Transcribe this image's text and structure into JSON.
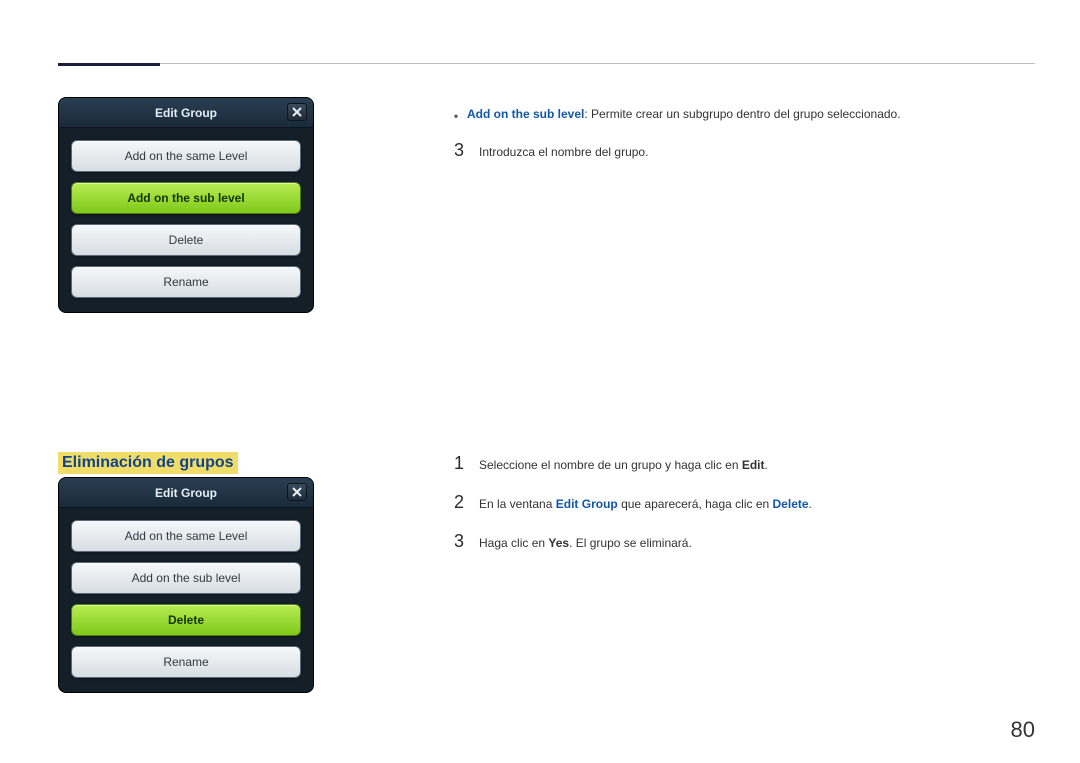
{
  "page": {
    "number": "80"
  },
  "dialog1": {
    "title": "Edit Group",
    "buttons": {
      "same": "Add on the same Level",
      "sub": "Add on the sub level",
      "delete": "Delete",
      "rename": "Rename"
    }
  },
  "dialog2": {
    "title": "Edit Group",
    "buttons": {
      "same": "Add on the same Level",
      "sub": "Add on the sub level",
      "delete": "Delete",
      "rename": "Rename"
    }
  },
  "section": {
    "heading": "Eliminación de grupos"
  },
  "text": {
    "bullet": {
      "term": "Add on the sub level",
      "desc": ": Permite crear un subgrupo dentro del grupo seleccionado."
    },
    "step3a": "Introduzca el nombre del grupo.",
    "steps2": {
      "s1_a": "Seleccione el nombre de un grupo y haga clic en ",
      "s1_b": "Edit",
      "s1_c": ".",
      "s2_a": "En la ventana ",
      "s2_b": "Edit Group",
      "s2_c": " que aparecerá, haga clic en ",
      "s2_d": "Delete",
      "s2_e": ".",
      "s3_a": "Haga clic en ",
      "s3_b": "Yes",
      "s3_c": ". El grupo se eliminará."
    }
  },
  "nums": {
    "n1": "1",
    "n2": "2",
    "n3": "3"
  }
}
